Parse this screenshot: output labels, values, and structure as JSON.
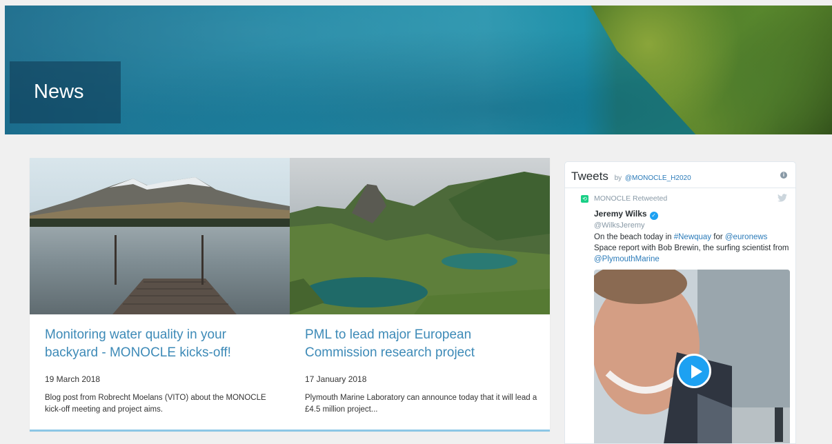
{
  "hero": {
    "title": "News"
  },
  "news": {
    "cards": [
      {
        "title": "Monitoring water quality in your backyard - MONOCLE kicks-off!",
        "date": "19 March 2018",
        "description": "Blog post from Robrecht Moelans (VITO) about the MONOCLE kick-off meeting and project aims."
      },
      {
        "title": "PML to lead major European Commission research project",
        "date": "17 January 2018",
        "description": "Plymouth Marine Laboratory can announce today that it will lead a £4.5 million project..."
      }
    ]
  },
  "tweets": {
    "title": "Tweets",
    "by": "by",
    "handle": "@MONOCLE_H2020",
    "info_glyph": "i",
    "retweet_label": "MONOCLE Retweeted",
    "author_name": "Jeremy Wilks",
    "author_handle": "@WilksJeremy",
    "text_parts": {
      "p1": "On the beach today in ",
      "hashtag": "#Newquay",
      "p2": " for ",
      "mention1": "@euronews",
      "p3": " Space report with Bob Brewin, the surfing scientist from ",
      "mention2": "@PlymouthMarine"
    }
  },
  "colors": {
    "link_blue": "#3d8ab7",
    "twitter_blue": "#1da1f2",
    "accent_line": "#8cc7e6"
  },
  "icons": {
    "retweet": "retweet-icon",
    "verified": "verified-badge-icon",
    "bird": "twitter-bird-icon",
    "play": "play-icon",
    "info": "info-icon"
  }
}
